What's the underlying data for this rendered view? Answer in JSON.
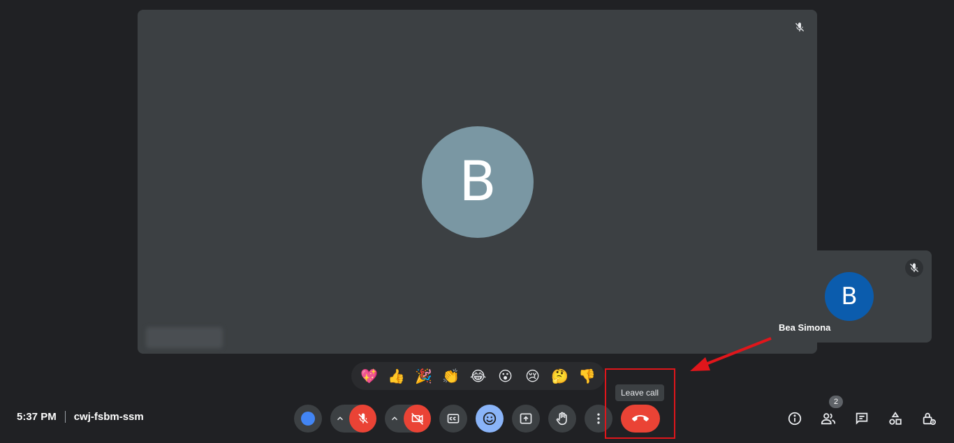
{
  "main_tile": {
    "avatar_letter": "B",
    "muted_icon": "mic-off-icon"
  },
  "self_tile": {
    "avatar_letter": "B",
    "name": "Bea Simona",
    "muted_icon": "mic-off-icon"
  },
  "reactions": [
    "💖",
    "👍",
    "🎉",
    "👏",
    "😂",
    "😮",
    "😢",
    "🤔",
    "👎"
  ],
  "tooltip": "Leave call",
  "meeting": {
    "time": "5:37 PM",
    "code": "cwj-fsbm-ssm"
  },
  "controls": {
    "hand_icon": "raise-hand-icon",
    "more_icon": "more-vert-icon",
    "hangup_icon": "call-end-icon"
  },
  "side_panel": {
    "people_count": "2"
  },
  "colors": {
    "background": "#202124",
    "tile": "#3c4043",
    "danger": "#ea4335",
    "accent_blue": "#4285f4",
    "reaction_active": "#8ab4f8",
    "annotation": "#e0161b"
  }
}
